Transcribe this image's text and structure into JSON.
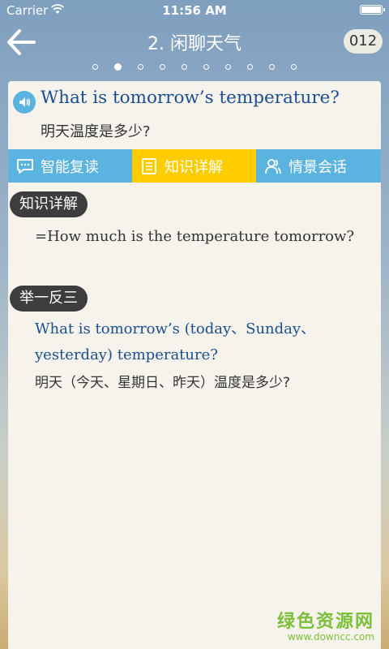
{
  "status_bar": {
    "carrier": "Carrier",
    "time": "11:56 AM"
  },
  "nav": {
    "title": "2. 闲聊天气",
    "lesson_number": "012"
  },
  "pager": {
    "total": 10,
    "active_index": 1
  },
  "sentence": {
    "english": "What is tomorrow’s temperature?",
    "chinese": "明天温度是多少?"
  },
  "tabs": [
    {
      "label": "智能复读",
      "icon": "chat-bubble-icon",
      "active": false
    },
    {
      "label": "知识详解",
      "icon": "document-icon",
      "active": true
    },
    {
      "label": "情景会话",
      "icon": "people-icon",
      "active": false
    }
  ],
  "knowledge": {
    "label": "知识详解",
    "text": "=How much is the temperature tomorrow?"
  },
  "examples": {
    "label": "举一反三",
    "english": "What is tomorrow’s (today、Sunday、yesterday) temperature?",
    "chinese": "明天（今天、星期日、昨天）温度是多少?"
  },
  "watermark": {
    "main": "绿色资源网",
    "sub": "www.downcc.com"
  },
  "colors": {
    "tab_blue": "#5bb4df",
    "tab_active": "#ffcc00",
    "english_text": "#1b4e8f",
    "label_bg": "#3d3d3d"
  }
}
